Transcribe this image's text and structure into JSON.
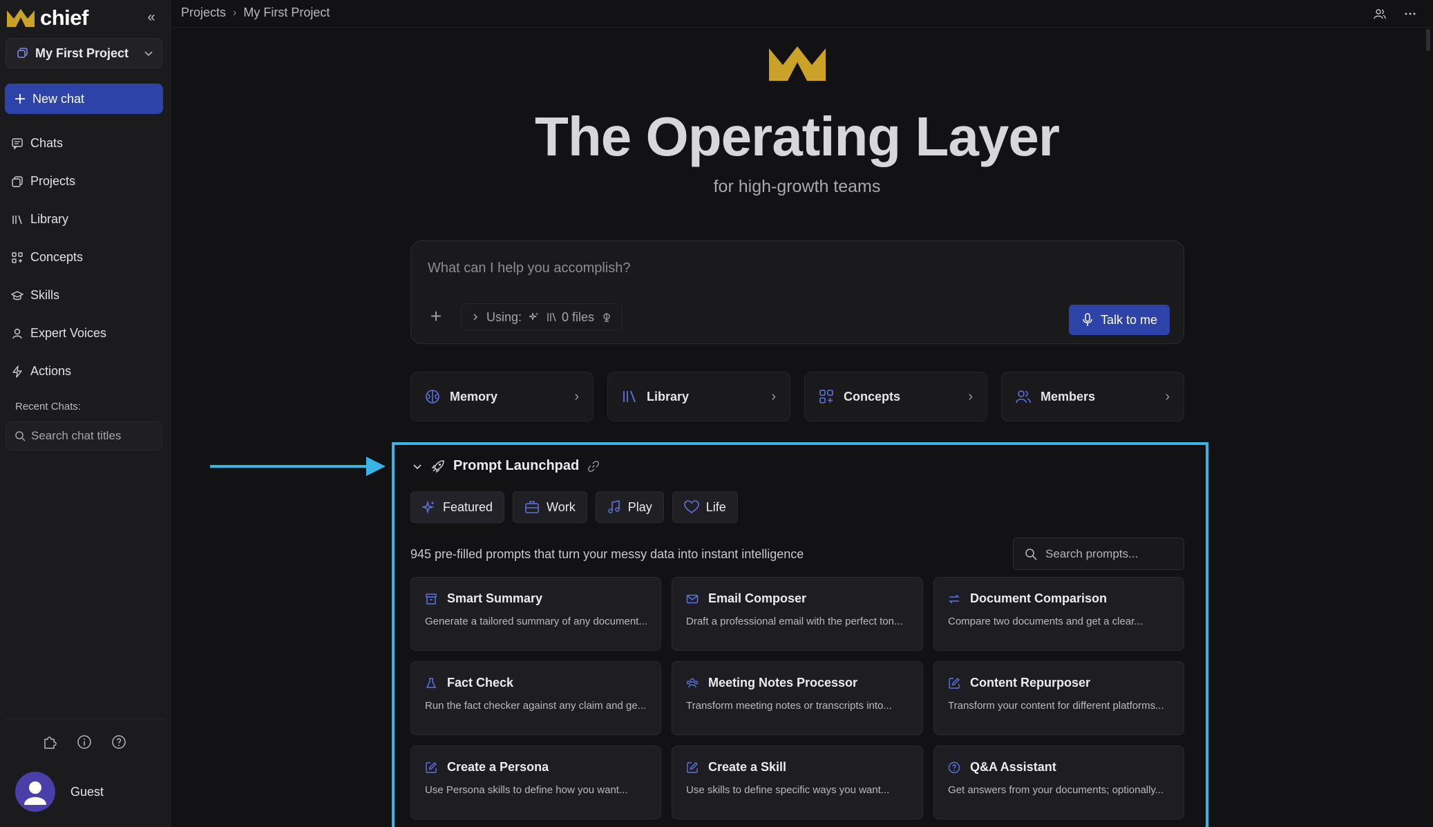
{
  "brand": {
    "name": "chief",
    "accent": "#c9a227"
  },
  "project": {
    "name": "My First Project"
  },
  "sidebar": {
    "new_chat": "New chat",
    "items": [
      {
        "label": "Chats",
        "icon": "chat-icon"
      },
      {
        "label": "Projects",
        "icon": "projects-icon"
      },
      {
        "label": "Library",
        "icon": "library-icon"
      },
      {
        "label": "Concepts",
        "icon": "concepts-icon"
      },
      {
        "label": "Skills",
        "icon": "skills-icon"
      },
      {
        "label": "Expert Voices",
        "icon": "person-icon"
      },
      {
        "label": "Actions",
        "icon": "bolt-icon"
      }
    ],
    "recent_label": "Recent Chats:",
    "search_placeholder": "Search chat titles",
    "user_name": "Guest"
  },
  "breadcrumb": {
    "root": "Projects",
    "current": "My First Project"
  },
  "hero": {
    "title": "The Operating Layer",
    "subtitle": "for high-growth teams"
  },
  "composer": {
    "placeholder": "What can I help you accomplish?",
    "using_label": "Using:",
    "files_label": "0 files",
    "talk_button": "Talk to me"
  },
  "quick_cards": [
    {
      "label": "Memory",
      "icon": "brain-icon"
    },
    {
      "label": "Library",
      "icon": "library-icon"
    },
    {
      "label": "Concepts",
      "icon": "concepts-icon"
    },
    {
      "label": "Members",
      "icon": "members-icon"
    }
  ],
  "launchpad": {
    "title": "Prompt Launchpad",
    "tabs": [
      {
        "label": "Featured",
        "icon": "sparkle-icon"
      },
      {
        "label": "Work",
        "icon": "briefcase-icon"
      },
      {
        "label": "Play",
        "icon": "music-icon"
      },
      {
        "label": "Life",
        "icon": "heart-icon"
      }
    ],
    "description": "945 pre-filled prompts that turn your messy data into instant intelligence",
    "search_placeholder": "Search prompts...",
    "prompts": [
      {
        "title": "Smart Summary",
        "desc": "Generate a tailored summary of any document...",
        "icon": "archive-icon"
      },
      {
        "title": "Email Composer",
        "desc": "Draft a professional email with the perfect ton...",
        "icon": "mail-icon"
      },
      {
        "title": "Document Comparison",
        "desc": "Compare two documents and get a clear...",
        "icon": "compare-icon"
      },
      {
        "title": "Fact Check",
        "desc": "Run the fact checker against any claim and ge...",
        "icon": "flask-icon"
      },
      {
        "title": "Meeting Notes Processor",
        "desc": "Transform meeting notes or transcripts into...",
        "icon": "meeting-icon"
      },
      {
        "title": "Content Repurposer",
        "desc": "Transform your content for different platforms...",
        "icon": "edit-icon"
      },
      {
        "title": "Create a Persona",
        "desc": "Use Persona skills to define how you want...",
        "icon": "edit-icon"
      },
      {
        "title": "Create a Skill",
        "desc": "Use skills to define specific ways you want...",
        "icon": "edit-icon"
      },
      {
        "title": "Q&A Assistant",
        "desc": "Get answers from your documents; optionally...",
        "icon": "question-icon"
      }
    ]
  },
  "colors": {
    "primary": "#2d43a7",
    "icon_blue": "#5b74e6",
    "highlight": "#38b4e6",
    "background": "#121214"
  }
}
